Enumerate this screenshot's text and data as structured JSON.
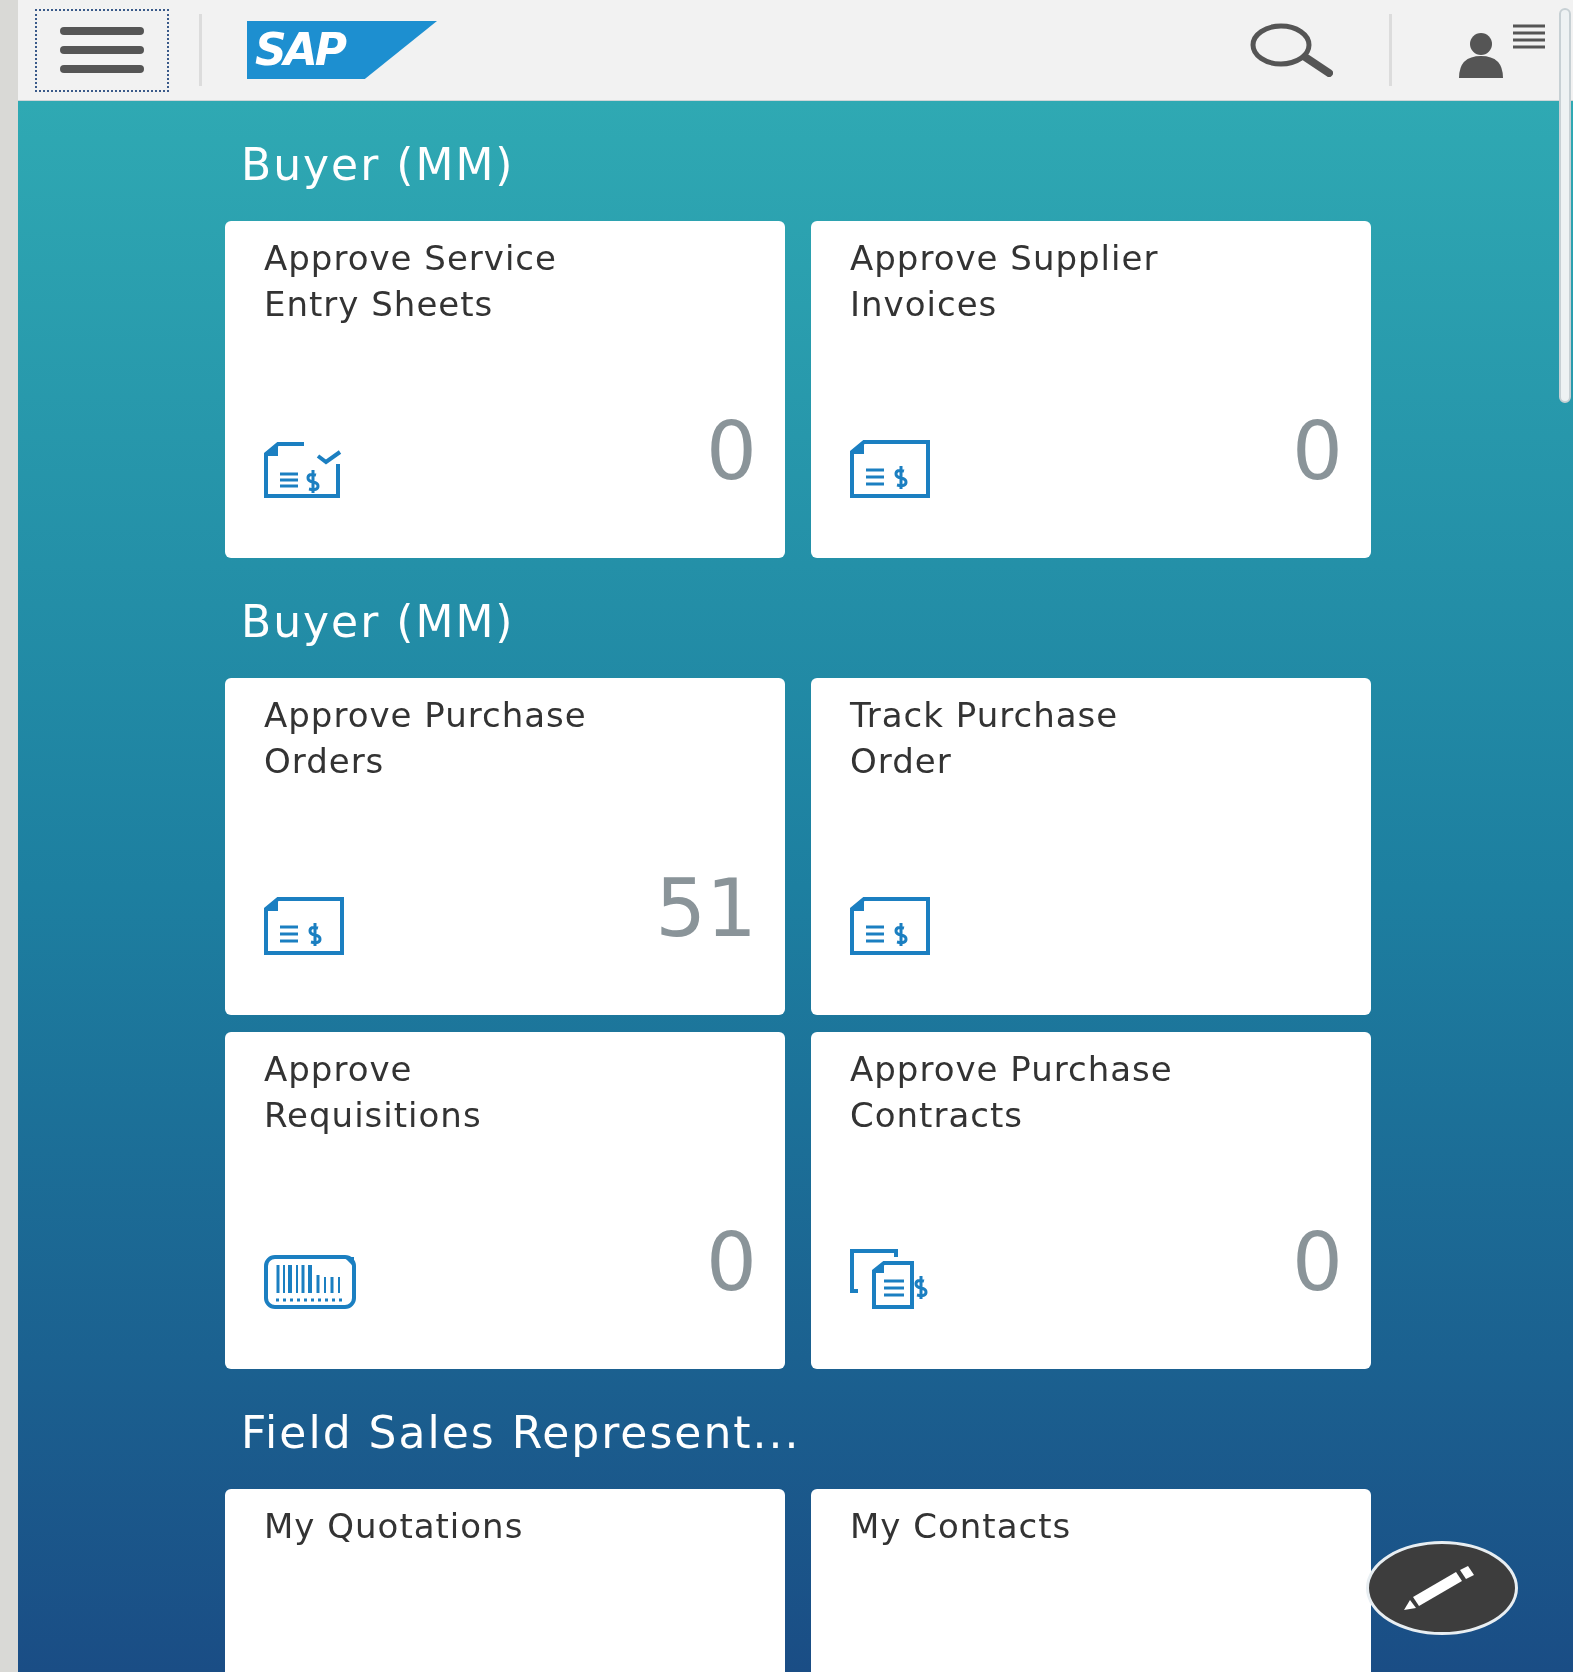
{
  "header": {
    "logo": "SAP"
  },
  "groups": [
    {
      "title": "Buyer (MM)",
      "tiles": [
        {
          "title": "Approve Service Entry Sheets",
          "kind": "approval",
          "count": "0"
        },
        {
          "title": "Approve Supplier Invoices",
          "kind": "invoice",
          "count": "0"
        }
      ]
    },
    {
      "title": "Buyer (MM)",
      "tiles": [
        {
          "title": "Approve Purchase Orders",
          "kind": "invoice",
          "count": "51"
        },
        {
          "title": "Track Purchase Order",
          "kind": "invoice"
        },
        {
          "title": "Approve Requisitions",
          "kind": "requisition",
          "count": "0"
        },
        {
          "title": "Approve Purchase Contracts",
          "kind": "contract",
          "count": "0"
        }
      ]
    },
    {
      "title": "Field Sales Represent...",
      "tiles": [
        {
          "title": "My Quotations"
        },
        {
          "title": "My Contacts"
        }
      ]
    }
  ]
}
